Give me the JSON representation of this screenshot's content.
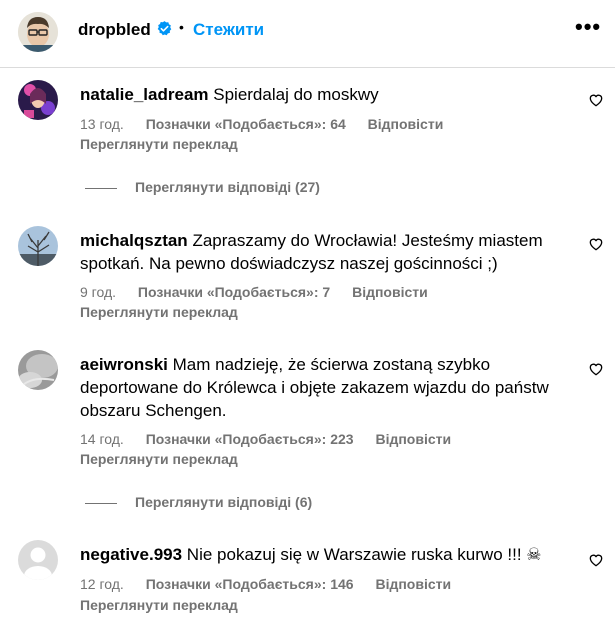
{
  "header": {
    "username": "dropbled",
    "separator": "•",
    "follow_label": "Стежити",
    "more_icon": "more-horizontal-icon",
    "verified_icon": "verified-badge-icon",
    "accent": "#0095f6"
  },
  "comments": [
    {
      "username": "natalie_ladream",
      "text": "Spierdalaj do moskwy",
      "time": "13 год.",
      "likes": "Позначки «Подобається»: 64",
      "reply": "Відповісти",
      "translate": "Переглянути переклад",
      "view_replies": "Переглянути відповіді (27)"
    },
    {
      "username": "michalqsztan",
      "text": "Zapraszamy do Wrocławia! Jesteśmy miastem spotkań. Na pewno doświadczysz naszej gościnności ;)",
      "time": "9 год.",
      "likes": "Позначки «Подобається»: 7",
      "reply": "Відповісти",
      "translate": "Переглянути переклад"
    },
    {
      "username": "aeiwronski",
      "text": "Mam nadzieję, że ścierwa zostaną szybko deportowane do Królewca i objęte zakazem wjazdu do państw obszaru Schengen.",
      "time": "14 год.",
      "likes": "Позначки «Подобається»: 223",
      "reply": "Відповісти",
      "translate": "Переглянути переклад",
      "view_replies": "Переглянути відповіді (6)"
    },
    {
      "username": "negative.993",
      "text": "Nie pokazuj się w Warszawie ruska kurwo !!! ☠",
      "time": "12 год.",
      "likes": "Позначки «Подобається»: 146",
      "reply": "Відповісти",
      "translate": "Переглянути переклад"
    }
  ],
  "colors": {
    "meta": "#737373",
    "divider": "#dbdbdb"
  }
}
